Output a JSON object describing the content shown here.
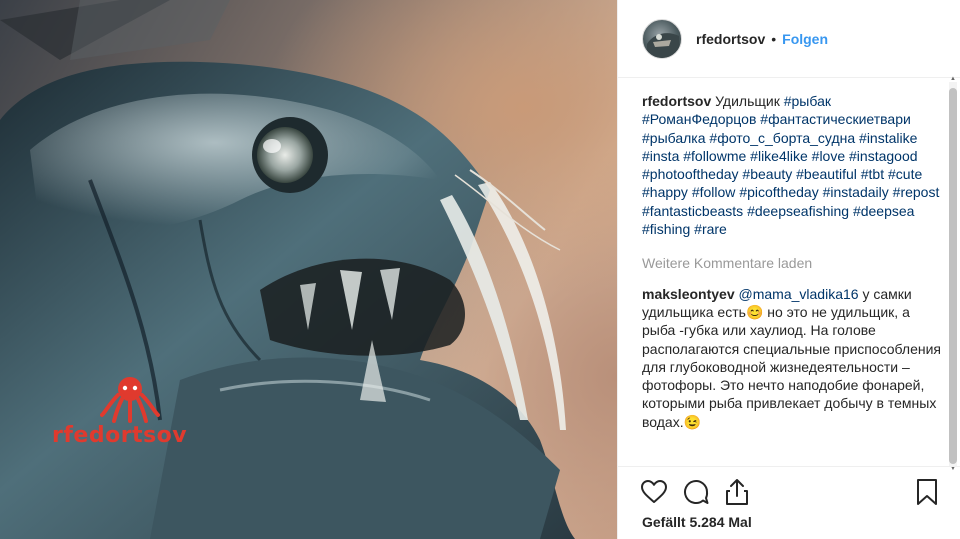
{
  "post": {
    "watermark": "rfedortsov",
    "author": "rfedortsov",
    "separator": "•",
    "follow_label": "Folgen"
  },
  "caption": {
    "user": "rfedortsov",
    "text": "Удильщик",
    "hashtags": [
      "#рыбак",
      "#РоманФедорцов",
      "#фантастическиетвари",
      "#рыбалка",
      "#фото_с_борта_судна",
      "#instalike",
      "#insta",
      "#followme",
      "#like4like",
      "#love",
      "#instagood",
      "#photooftheday",
      "#beauty",
      "#beautiful",
      "#tbt",
      "#cute",
      "#happy",
      "#follow",
      "#picoftheday",
      "#instadaily",
      "#repost",
      "#fantasticbeasts",
      "#deepseafishing",
      "#deepsea",
      "#fishing",
      "#rare"
    ]
  },
  "load_more": "Weitere Kommentare laden",
  "comment": {
    "user": "maksleontyev",
    "mention": "@mama_vladika16",
    "text_part1": "у самки удильщика есть",
    "emoji1": "😊",
    "text_part2": "но это не удильщик, а рыба -губка или хаулиод. На голове располагаются специальные приспособления для глубоководной жизнедеятельности – фотофоры. Это нечто наподобие фонарей, которыми рыба привлекает добычу в темных водах.",
    "emoji2": "😉"
  },
  "likes_text": "Gefällt 5.284 Mal",
  "icons": {
    "like": "heart-icon",
    "comment": "comment-icon",
    "share": "share-icon",
    "save": "bookmark-icon"
  },
  "colors": {
    "link": "#3897f0",
    "hashtag": "#003569",
    "muted": "#999999",
    "watermark": "#e03a2e"
  }
}
